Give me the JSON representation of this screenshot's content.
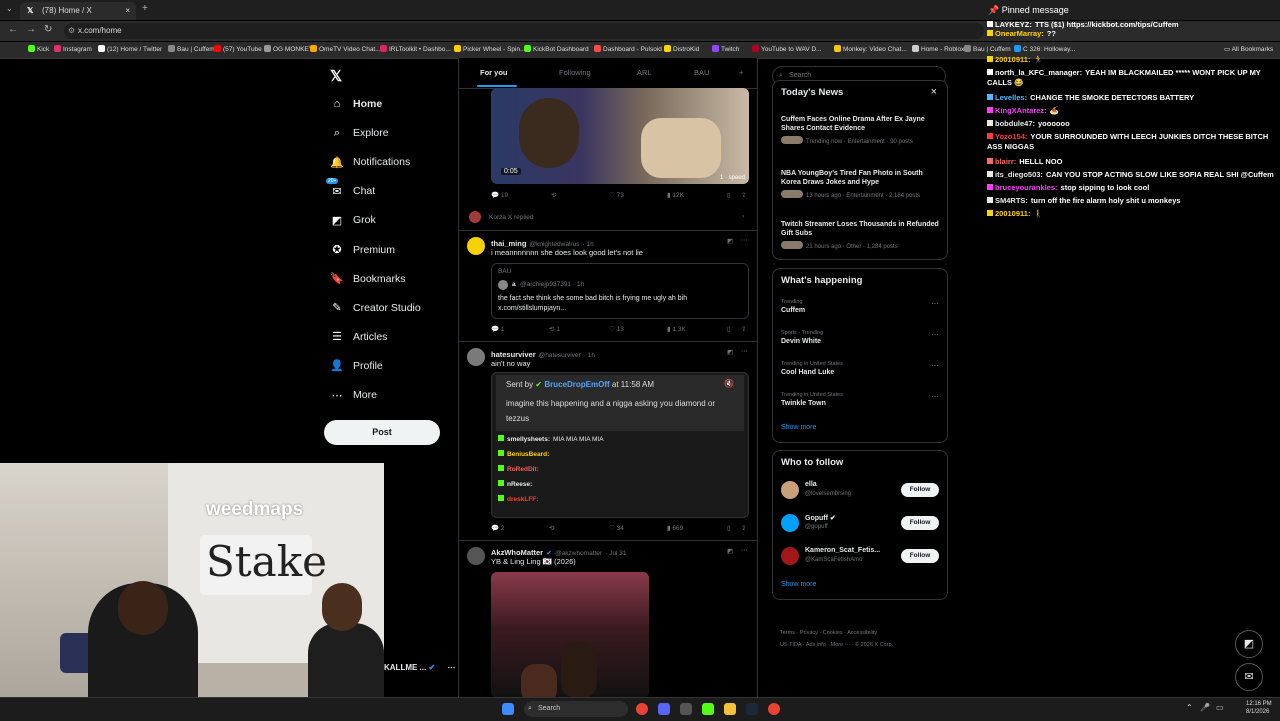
{
  "browser": {
    "tabs": [
      {
        "label": "(78) Home / X"
      }
    ],
    "new_tab": "+",
    "url": "x.com/home",
    "bookmarks": [
      {
        "label": "Kick",
        "color": "#53fc18"
      },
      {
        "label": "Instagram",
        "color": "#e1306c"
      },
      {
        "label": "(12) Home / Twitter",
        "color": "#ffffff"
      },
      {
        "label": "Bau | Cuffem",
        "color": "#888888"
      },
      {
        "label": "(57) YouTube",
        "color": "#ff0000"
      },
      {
        "label": "OG MONKEY",
        "color": "#999999"
      },
      {
        "label": "OmeTV Video Chat...",
        "color": "#f7a700"
      },
      {
        "label": "IRLToolkit • Dashbo...",
        "color": "#e0245e"
      },
      {
        "label": "Picker Wheel - Spin...",
        "color": "#ffcc00"
      },
      {
        "label": "KickBot Dashboard",
        "color": "#53fc18"
      },
      {
        "label": "Dashboard - Pulsoid",
        "color": "#ff4a4a"
      },
      {
        "label": "DistroKid",
        "color": "#ffd500"
      },
      {
        "label": "Twitch",
        "color": "#9146ff"
      },
      {
        "label": "YouTube to WAV D...",
        "color": "#b00020"
      },
      {
        "label": "Monkey: Video Chat...",
        "color": "#f5c518"
      },
      {
        "label": "Home - Roblox",
        "color": "#cccccc"
      },
      {
        "label": "Bau | Cuffem",
        "color": "#888888"
      },
      {
        "label": "C 326: Holloway...",
        "color": "#1d9bf0"
      }
    ],
    "all_bookmarks": "All Bookmarks"
  },
  "sidebar": {
    "items": [
      {
        "label": "Home",
        "icon": "home-icon",
        "glyph": "⌂"
      },
      {
        "label": "Explore",
        "icon": "search-icon",
        "glyph": "⌕"
      },
      {
        "label": "Notifications",
        "icon": "bell-icon",
        "glyph": "🔔"
      },
      {
        "label": "Chat",
        "icon": "chat-icon",
        "glyph": "✉"
      },
      {
        "label": "Grok",
        "icon": "grok-icon",
        "glyph": "◩"
      },
      {
        "label": "Premium",
        "icon": "premium-icon",
        "glyph": "✪"
      },
      {
        "label": "Bookmarks",
        "icon": "bookmark-icon",
        "glyph": "🔖"
      },
      {
        "label": "Creator Studio",
        "icon": "creator-icon",
        "glyph": "✎"
      },
      {
        "label": "Articles",
        "icon": "articles-icon",
        "glyph": "☰"
      },
      {
        "label": "Profile",
        "icon": "profile-icon",
        "glyph": "👤"
      },
      {
        "label": "More",
        "icon": "more-icon",
        "glyph": "⋯"
      }
    ],
    "chat_badge": "20+",
    "post_label": "Post",
    "account_name": "KALLME ..."
  },
  "timeline": {
    "tabs": [
      "For you",
      "Following",
      "ARL",
      "BAU"
    ],
    "add_tab": "+",
    "video": {
      "time": "0:05",
      "speed_label": "1 · speed"
    },
    "video_actions": {
      "replies": "10",
      "likes": "73",
      "views": "12K"
    },
    "replied_label": "Korza X replied",
    "tweets": [
      {
        "name": "thai_ming",
        "handle": "@knightedwalrus",
        "time": "· 1h",
        "text": "i meannnnnnn she does look good let's not lie",
        "quote_top": "BAU",
        "quote_user": "a",
        "quote_handle": "@archiejp937391 · 1h",
        "quote_text": "the fact she think she some bad bitch is frying me ugly ah bih x.com/stillslumpjayn...",
        "replies": "1",
        "retweets": "1",
        "likes": "13",
        "views": "1.3K"
      },
      {
        "name": "hatesurviver",
        "handle": "@hatesurviver",
        "time": "· 1h",
        "text": "ain't no way",
        "sent_by_prefix": "Sent by",
        "sent_by_user": "BruceDropEmOff",
        "sent_by_time": "at 11:58 AM",
        "embed_text": "imagine this happening and a nigga asking you diamond or tezzus",
        "embed_chat": [
          {
            "user": "smellysheets:",
            "text": "MIA  MIA  MIA  MIA",
            "color": "#e7e9ea"
          },
          {
            "user": "BeniusBeard:",
            "text": "",
            "color": "#ffd400"
          },
          {
            "user": "RoRedDit:",
            "text": "",
            "color": "#ff5a5a"
          },
          {
            "user": "nReese:",
            "text": "",
            "color": "#e7e9ea"
          },
          {
            "user": "dreskLFF:",
            "text": "",
            "color": "#ff3b30"
          }
        ],
        "replies": "2",
        "retweets": "",
        "likes": "34",
        "views": "669"
      },
      {
        "name": "AkzWhoMatter",
        "handle": "@akzwhomatter",
        "time": "· Jul 31",
        "text": "YB & Ling Ling 🇰🇷 (2026)"
      }
    ]
  },
  "right": {
    "search_placeholder": "Search",
    "todays_news": {
      "title": "Today's News",
      "close": "×",
      "items": [
        {
          "title": "Cuffem Faces Online Drama After Ex Jayne Shares Contact Evidence",
          "meta": "Trending now · Entertainment · 90 posts"
        },
        {
          "title": "NBA YoungBoy's Tired Fan Photo in South Korea Draws Jokes and Hype",
          "meta": "13 hours ago · Entertainment · 2,184 posts"
        },
        {
          "title": "Twitch Streamer Loses Thousands in Refunded Gift Subs",
          "meta": "21 hours ago · Other · 1,284 posts"
        }
      ]
    },
    "whats_happening": {
      "title": "What's happening",
      "items": [
        {
          "context": "Trending",
          "name": "Cuffem"
        },
        {
          "context": "Sports · Trending",
          "name": "Devin White"
        },
        {
          "context": "Trending in United States",
          "name": "Cool Hand Luke"
        },
        {
          "context": "Trending in United States",
          "name": "Twinkle Town"
        }
      ],
      "show_more": "Show more"
    },
    "who_to_follow": {
      "title": "Who to follow",
      "items": [
        {
          "name": "ella",
          "handle": "@lovelsembrsing",
          "color": "#c8a07a"
        },
        {
          "name": "Gopuff ✔",
          "handle": "@gopuff",
          "color": "#00a0ff"
        },
        {
          "name": "Kameron_Scat_Fetis...",
          "handle": "@KamScaFetishAmo",
          "color": "#a01818"
        }
      ],
      "follow_label": "Follow",
      "show_more": "Show more"
    },
    "footer": {
      "line1": "Terms · Privacy · Cookies · Accessibility",
      "line2": "US TIDA · Ads info · More ··· · © 2026 X Corp."
    }
  },
  "chat": {
    "pinned_label": "Pinned message",
    "lines": [
      {
        "user": "LAYKEYZ:",
        "text": "TTS ($1) https://kickbot.com/tips/Cuffem",
        "color": "#ffffff"
      },
      {
        "user": "OnearMarray:",
        "text": "??",
        "color": "#ffd400"
      },
      {
        "user": "20010911:",
        "text": "🏃",
        "color": "#ffd400"
      },
      {
        "user": "north_la_KFC_manager:",
        "text": "YEAH IM BLACKMAILED ***** WONT PICK UP MY CALLS 😂",
        "color": "#ffffff"
      },
      {
        "user": "Levelles:",
        "text": "CHANGE THE SMOKE DETECTORS BATTERY",
        "color": "#53b8ff"
      },
      {
        "user": "KingXAntarez:",
        "text": "🍝",
        "color": "#ff3bff"
      },
      {
        "user": "bobdule47:",
        "text": "yoooooo",
        "color": "#e7e9ea"
      },
      {
        "user": "Yozo154:",
        "text": "YOUR SURROUNDED WITH LEECH JUNKIES DITCH THESE BITCH ASS NIGGAS",
        "color": "#ff3b3b"
      },
      {
        "user": "blairr:",
        "text": "HELLL NOO",
        "color": "#ff6a6a"
      },
      {
        "user": "its_diego503:",
        "text": "CAN YOU STOP ACTING SLOW LIKE SOFIA REAL SHI @Cuffem",
        "color": "#e7e9ea"
      },
      {
        "user": "bruceyourankles:",
        "text": "stop sipping to look cool",
        "color": "#ff3bff"
      },
      {
        "user": "SM4RTS:",
        "text": "turn off the fire alarm holy shit u monkeys",
        "color": "#e7e9ea"
      },
      {
        "user": "20010911:",
        "text": "🚶",
        "color": "#ffd400"
      }
    ]
  },
  "cam": {
    "banner_top": "weedmaps",
    "banner_main": "Stake"
  },
  "taskbar": {
    "search_placeholder": "Search",
    "time": "12:16 PM",
    "date": "8/1/2026"
  }
}
